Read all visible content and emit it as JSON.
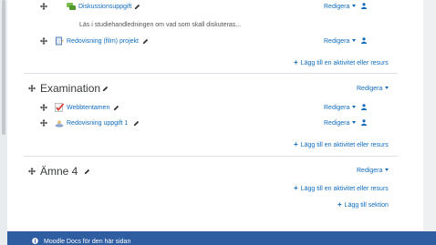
{
  "section_top": {
    "activities": [
      {
        "label": "Diskussionsuppgift",
        "edit": "Redigera",
        "description": "Läs i studiehandledningen om vad som skall diskuteras...",
        "icon": "forum-icon"
      },
      {
        "label": "Redovisning (film) projekt",
        "edit": "Redigera",
        "icon": "assignment-icon"
      }
    ],
    "add_activity": "Lägg till en aktivitet eller resurs"
  },
  "section_examination": {
    "title": "Examination",
    "edit": "Redigera",
    "activities": [
      {
        "label": "Webbtentamen",
        "edit": "Redigera",
        "icon": "quiz-icon"
      },
      {
        "label": "Redovisning uppgift 1",
        "edit": "Redigera",
        "icon": "assignment-icon"
      }
    ],
    "add_activity": "Lägg till en aktivitet eller resurs"
  },
  "section_amne4": {
    "title": "Ämne 4",
    "edit": "Redigera",
    "add_activity": "Lägg till en aktivitet eller resurs",
    "add_section": "Lägg till sektion"
  },
  "footer": {
    "docs_link": "Moodle Docs för den här sidan"
  },
  "colors": {
    "link": "#0f6cbf",
    "footer_bg": "#2f5da1"
  }
}
